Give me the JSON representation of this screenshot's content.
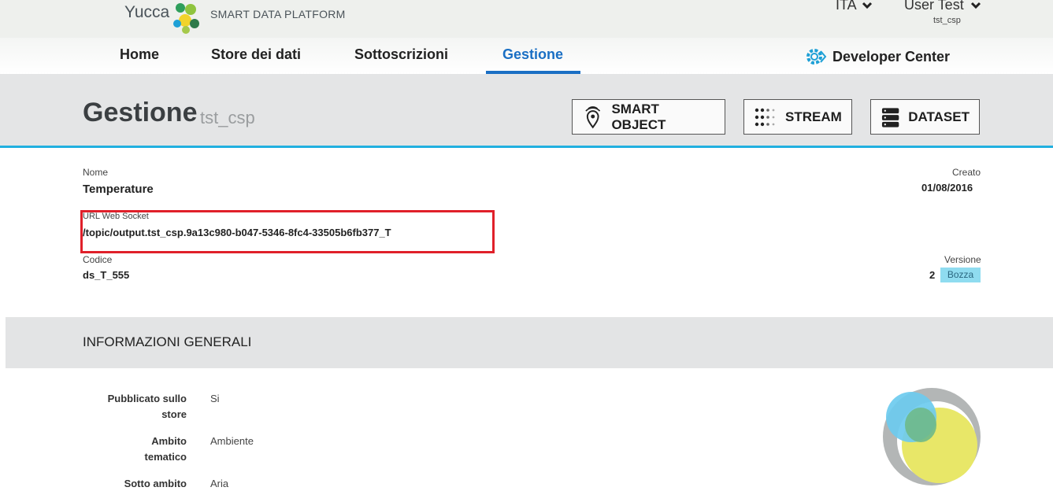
{
  "header": {
    "brand": "Yucca",
    "platform": "SMART DATA PLATFORM",
    "language": "ITA",
    "user_name": "User Test",
    "user_tenant": "tst_csp"
  },
  "nav": {
    "items": [
      "Home",
      "Store dei dati",
      "Sottoscrizioni",
      "Gestione"
    ],
    "active": "Gestione",
    "developer_center": "Developer Center"
  },
  "page": {
    "title": "Gestione",
    "subtitle": "tst_csp",
    "buttons": [
      "SMART OBJECT",
      "STREAM",
      "DATASET"
    ]
  },
  "details": {
    "nome_label": "Nome",
    "nome_value": "Temperature",
    "creato_label": "Creato",
    "creato_value": "01/08/2016",
    "url_label": "URL Web Socket",
    "url_value": "/topic/output.tst_csp.9a13c980-b047-5346-8fc4-33505b6fb377_T",
    "codice_label": "Codice",
    "codice_value": "ds_T_555",
    "versione_label": "Versione",
    "versione_value": "2",
    "status_badge": "Bozza"
  },
  "section": {
    "title": "INFORMAZIONI GENERALI",
    "rows": [
      {
        "key_line1": "Pubblicato sullo",
        "key_line2": "store",
        "value": "Si"
      },
      {
        "key_line1": "Ambito",
        "key_line2": "tematico",
        "value": "Ambiente"
      },
      {
        "key_line1": "Sotto ambito",
        "key_line2": "",
        "value": "Aria"
      }
    ]
  },
  "colors": {
    "accent": "#1a6fc4",
    "band_border": "#21b0e0",
    "highlight": "#e0202a",
    "badge": "#8fdcf0"
  }
}
